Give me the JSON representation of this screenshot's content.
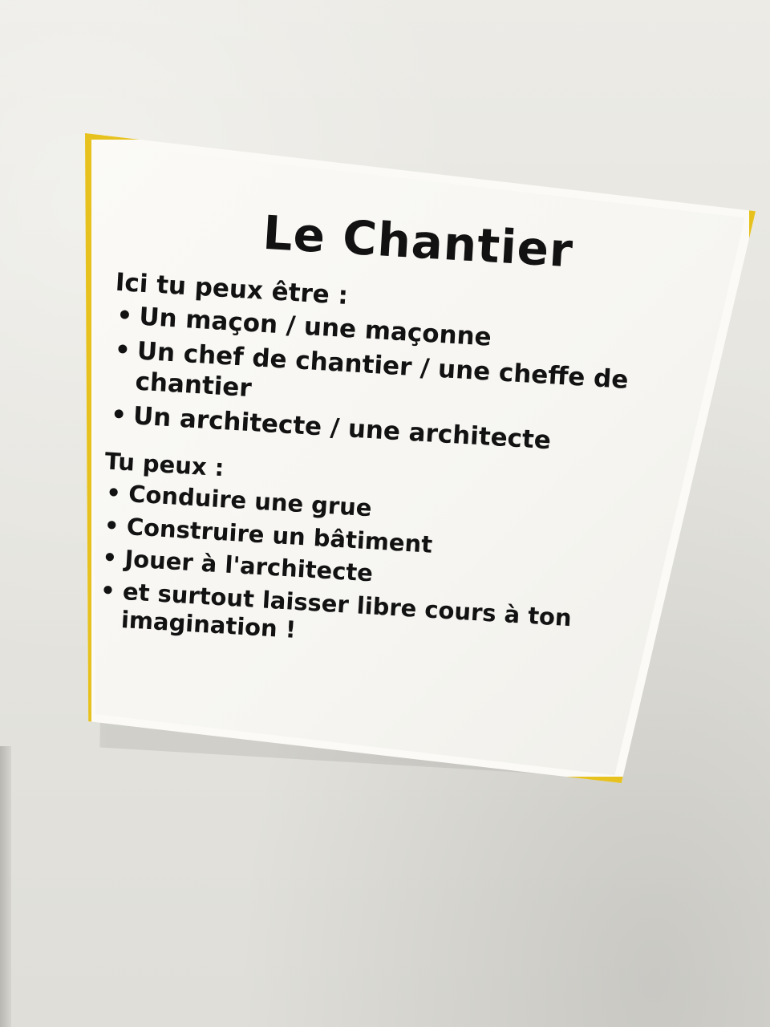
{
  "sign": {
    "title": "Le Chantier",
    "sections": [
      {
        "heading": "Ici tu peux être :",
        "items": [
          "Un maçon / une maçonne",
          "Un chef de chantier / une cheffe de chantier",
          "Un architecte / une architecte"
        ]
      },
      {
        "heading": "Tu peux :",
        "items": [
          "Conduire une grue",
          "Construire un bâtiment",
          "Jouer à l'architecte",
          "et surtout laisser libre cours à ton imagination !"
        ]
      }
    ]
  },
  "colors": {
    "border": "#e7c21e",
    "sign_background": "#fbfaf6",
    "text": "#121212",
    "wall": "#e9e8e3"
  }
}
